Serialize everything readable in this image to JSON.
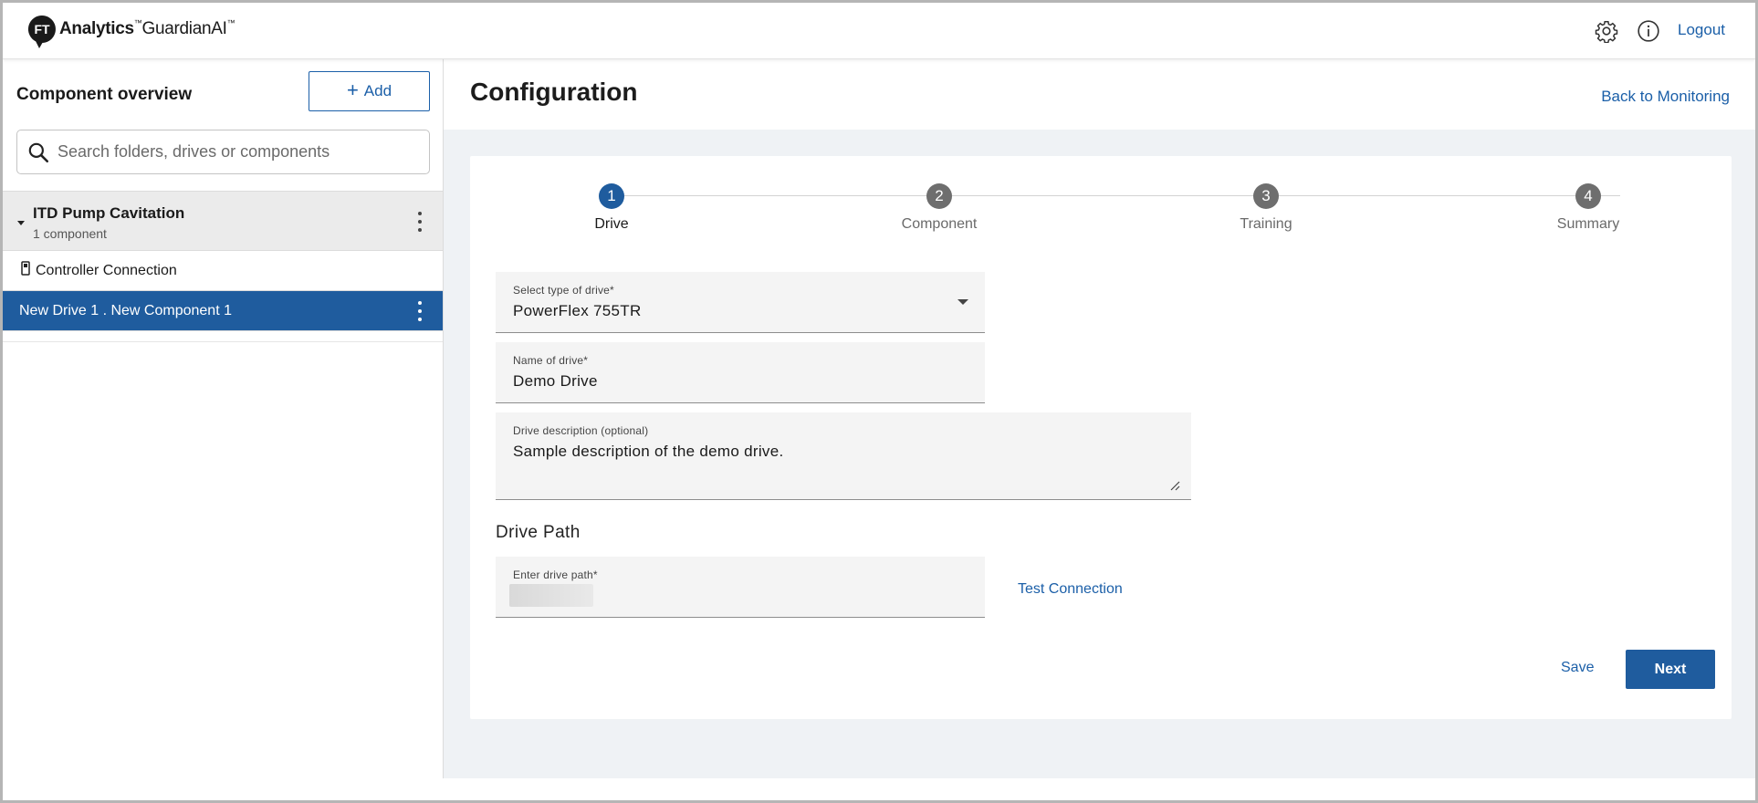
{
  "header": {
    "logo_primary": "Analytics",
    "logo_secondary": "GuardianAI",
    "logo_tm": "™",
    "logout_label": "Logout",
    "icons": [
      "gear-icon",
      "info-icon"
    ]
  },
  "sidebar": {
    "title": "Component overview",
    "add_label": "Add",
    "search_placeholder": "Search folders, drives or components",
    "folder": {
      "name": "ITD Pump Cavitation",
      "count": "1 component"
    },
    "items": [
      {
        "label": "Controller Connection",
        "icon": "controller-icon",
        "selected": false
      },
      {
        "label": "New Drive 1 . New Component 1",
        "selected": true
      }
    ]
  },
  "main": {
    "title": "Configuration",
    "back_label": "Back to Monitoring",
    "steps": [
      {
        "number": "1",
        "label": "Drive",
        "active": true
      },
      {
        "number": "2",
        "label": "Component",
        "active": false
      },
      {
        "number": "3",
        "label": "Training",
        "active": false
      },
      {
        "number": "4",
        "label": "Summary",
        "active": false
      }
    ],
    "form": {
      "drive_type": {
        "label": "Select type of drive*",
        "value": "PowerFlex 755TR"
      },
      "drive_name": {
        "label": "Name of drive*",
        "value": "Demo Drive"
      },
      "drive_description": {
        "label": "Drive description (optional)",
        "value": "Sample description of the demo drive."
      },
      "section_title": "Drive Path",
      "drive_path": {
        "label": "Enter drive path*",
        "value": ""
      },
      "test_connection_label": "Test Connection",
      "save_label": "Save",
      "next_label": "Next"
    }
  },
  "colors": {
    "accent": "#1f5c9e",
    "link": "#1b5fa8",
    "main_bg": "#eff2f5",
    "inactive_step": "#6e6e6e"
  }
}
